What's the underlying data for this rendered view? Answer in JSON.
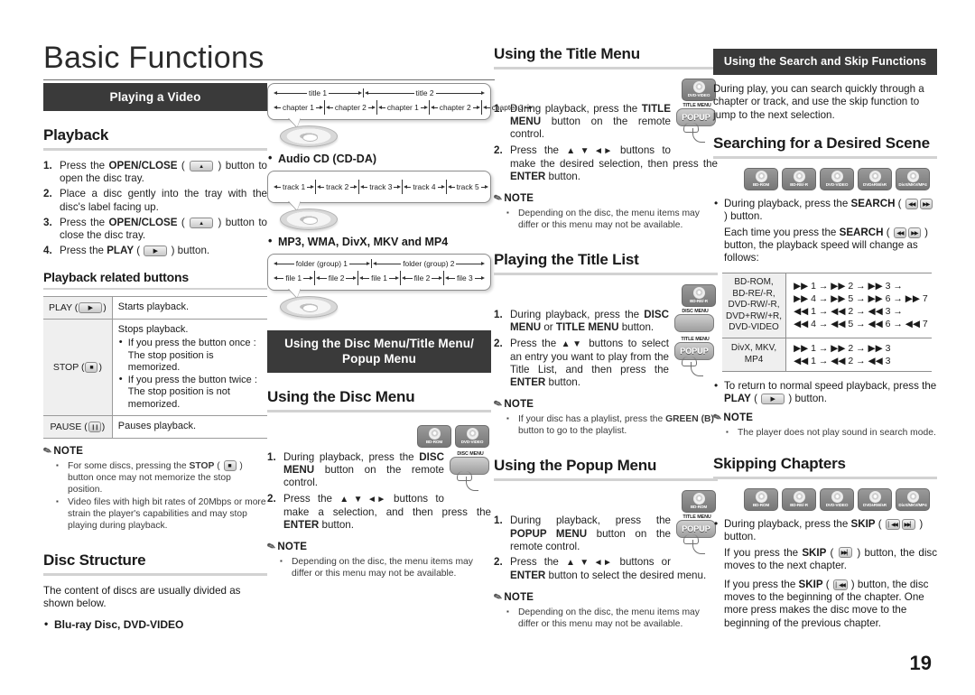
{
  "page": {
    "title": "Basic Functions",
    "number": "19"
  },
  "col1": {
    "banner": "Playing a Video",
    "playback": {
      "heading": "Playback",
      "steps": [
        {
          "pre": "Press the ",
          "b1": "OPEN/CLOSE",
          "mid": " ( ",
          "key": "eject",
          "post": " ) button to open the disc tray."
        },
        {
          "pre": "Place a disc gently into the tray with the disc's label facing up.",
          "b1": "",
          "mid": "",
          "key": "",
          "post": ""
        },
        {
          "pre": "Press the ",
          "b1": "OPEN/CLOSE",
          "mid": " ( ",
          "key": "eject",
          "post": " ) button to close the disc tray."
        },
        {
          "pre": "Press the ",
          "b1": "PLAY",
          "mid": " ( ",
          "key": "play",
          "post": " ) button."
        }
      ]
    },
    "buttons_table": {
      "heading": "Playback related buttons",
      "rows": [
        {
          "name": "PLAY (",
          "key": "play",
          "name_end": ")",
          "desc": "Starts playback.",
          "sub": []
        },
        {
          "name": "STOP (",
          "key": "stop",
          "name_end": ")",
          "desc": "Stops playback.",
          "sub": [
            "If you press the button once : The stop position is memorized.",
            "If you press the button twice : The stop position is not memorized."
          ]
        },
        {
          "name": "PAUSE (",
          "key": "pause",
          "name_end": ")",
          "desc": "Pauses playback.",
          "sub": []
        }
      ]
    },
    "note": {
      "label": "NOTE",
      "items": [
        {
          "pre": "For some discs, pressing the ",
          "b": "STOP",
          "mid": " ( ",
          "key": "stop",
          "post": " ) button once may not memorize the stop position."
        },
        {
          "pre": "Video files with high bit rates of 20Mbps or more strain the player's capabilities and may stop playing during playback.",
          "b": "",
          "mid": "",
          "key": "",
          "post": ""
        }
      ]
    },
    "disc_structure": {
      "heading": "Disc Structure",
      "body": "The content of discs are usually divided as shown below.",
      "bullet": "Blu-ray Disc, DVD-VIDEO"
    }
  },
  "col2": {
    "diagram_bd": {
      "row1": [
        "title 1",
        "title 2"
      ],
      "row2": [
        "chapter 1",
        "chapter 2",
        "chapter 1",
        "chapter 2",
        "chapter 3"
      ]
    },
    "label_audio_cd": "Audio CD (CD-DA)",
    "diagram_cd": {
      "row1": [
        "track 1",
        "track 2",
        "track 3",
        "track 4",
        "track 5"
      ]
    },
    "label_mp3": "MP3, WMA, DivX, MKV and MP4",
    "diagram_mp3": {
      "row1": [
        "folder (group) 1",
        "folder (group) 2"
      ],
      "row2": [
        "file 1",
        "file 2",
        "file 1",
        "file 2",
        "file 3"
      ]
    },
    "banner_line1": "Using the Disc Menu/Title Menu/",
    "banner_line2": "Popup Menu",
    "disc_menu": {
      "heading": "Using the Disc Menu",
      "badges": [
        "BD-ROM",
        "DVD-VIDEO"
      ],
      "remote_caption": "DISC MENU",
      "remote_label": "",
      "steps": [
        {
          "pre": "During playback, press the ",
          "b1": "DISC MENU",
          "post": " button on the remote control."
        },
        {
          "pre": "Press the ",
          "arrows": "▲▼◄►",
          "mid": " buttons to make a selection, and then press the ",
          "b2": "ENTER",
          "post": " button."
        }
      ],
      "note": {
        "label": "NOTE",
        "items": [
          "Depending on the disc, the menu items may differ or this menu may not be available."
        ]
      }
    }
  },
  "col3": {
    "title_menu": {
      "heading": "Using the Title Menu",
      "badges": [
        "DVD-VIDEO"
      ],
      "remote_caption": "TITLE MENU",
      "remote_label": "POPUP",
      "steps": [
        {
          "pre": "During playback, press the ",
          "b1": "TITLE MENU",
          "post": " button on the remote control."
        },
        {
          "pre": "Press the ",
          "arrows": "▲▼◄►",
          "mid": " buttons to make the desired selection, then press the ",
          "b2": "ENTER",
          "post": " button."
        }
      ],
      "note": {
        "label": "NOTE",
        "items": [
          "Depending on the disc, the menu items may differ or this menu may not be available."
        ]
      }
    },
    "title_list": {
      "heading": "Playing the Title List",
      "badges": [
        "BD-RE/-R"
      ],
      "remote1_caption": "DISC MENU",
      "remote2_caption": "TITLE MENU",
      "remote2_label": "POPUP",
      "steps": [
        {
          "pre": "During playback, press the ",
          "b1": "DISC MENU",
          "mid2": " or ",
          "b2": "TITLE MENU",
          "post": " button."
        },
        {
          "pre": "Press the ",
          "arrows": "▲▼",
          "mid": " buttons to select an entry you want to play from the Title List, and then press the ",
          "b2": "ENTER",
          "post": " button."
        }
      ],
      "note": {
        "label": "NOTE",
        "items_rich": [
          {
            "pre": "If your disc has a playlist, press the ",
            "b": "GREEN (B)",
            "post": " button to go to the playlist."
          }
        ]
      }
    },
    "popup_menu": {
      "heading": "Using the Popup Menu",
      "badges": [
        "BD-ROM"
      ],
      "remote_caption": "TITLE MENU",
      "remote_label": "POPUP",
      "steps": [
        {
          "pre": "During playback, press the ",
          "b1": "POPUP MENU",
          "post": " button on the remote control."
        },
        {
          "pre": "Press the ",
          "arrows": "▲▼◄►",
          "mid": " buttons or ",
          "b2": "ENTER",
          "post": " button to select the desired menu."
        }
      ],
      "note": {
        "label": "NOTE",
        "items": [
          "Depending on the disc, the menu items may differ or this menu may not be available."
        ]
      }
    }
  },
  "col4": {
    "banner": "Using the Search and Skip Functions",
    "intro": "During play, you can search quickly through a chapter or track, and use the skip function to jump to the next selection.",
    "search": {
      "heading": "Searching for a Desired Scene",
      "badges": [
        "BD-ROM",
        "BD-RE/-R",
        "DVD-VIDEO",
        "DVD±RW/±R",
        "DivX/MKV/MP4"
      ],
      "bullet1": {
        "pre": "During playback, press the ",
        "b": "SEARCH",
        "mid": " ( ",
        "k1": "frew",
        "k2": "ffwd",
        "post": " ) button."
      },
      "line2": {
        "pre": "Each time you press the ",
        "b": "SEARCH",
        "mid": " ( ",
        "k1": "frew",
        "k2": "ffwd",
        "post": " ) button, the playback speed will change as follows:"
      },
      "table": {
        "rows": [
          {
            "label": "BD-ROM,\nBD-RE/-R,\nDVD-RW/-R,\nDVD+RW/+R,\nDVD-VIDEO",
            "label_lines": [
              "BD-ROM,",
              "BD-RE/-R,",
              "DVD-RW/-R,",
              "DVD+RW/+R,",
              "DVD-VIDEO"
            ],
            "values": [
              "▶▶ 1 → ▶▶ 2 → ▶▶ 3 →",
              "▶▶ 4 → ▶▶ 5 → ▶▶ 6 → ▶▶ 7",
              "◀◀ 1 → ◀◀ 2 → ◀◀ 3 →",
              "◀◀ 4 → ◀◀ 5 → ◀◀ 6 → ◀◀ 7"
            ]
          },
          {
            "label_lines": [
              "DivX, MKV,",
              "MP4"
            ],
            "values": [
              "▶▶ 1 → ▶▶ 2 → ▶▶ 3",
              "◀◀ 1 → ◀◀ 2 → ◀◀ 3"
            ]
          }
        ]
      },
      "bullet2": {
        "pre": "To return to normal speed playback, press the ",
        "b": "PLAY",
        "mid": " ( ",
        "k1": "play",
        "post": " ) button."
      },
      "note": {
        "label": "NOTE",
        "items": [
          "The player does not play sound in search mode."
        ]
      }
    },
    "skip": {
      "heading": "Skipping Chapters",
      "badges": [
        "BD-ROM",
        "BD-RE/-R",
        "DVD-VIDEO",
        "DVD±RW/±R",
        "DivX/MKV/MP4"
      ],
      "bullet": {
        "pre": "During playback, press the ",
        "b": "SKIP",
        "mid": " ( ",
        "k1": "prev",
        "k2": "next",
        "post": " ) button."
      },
      "line2": {
        "pre": "If you press the ",
        "b": "SKIP",
        "mid": " ( ",
        "k1": "next",
        "post": " ) button, the disc moves to the next chapter."
      },
      "line3": {
        "pre": "If you press the ",
        "b": "SKIP",
        "mid": " ( ",
        "k1": "prev",
        "post": " ) button, the disc moves to the beginning of the chapter. One more press makes the disc move to the beginning of the previous chapter."
      }
    }
  }
}
